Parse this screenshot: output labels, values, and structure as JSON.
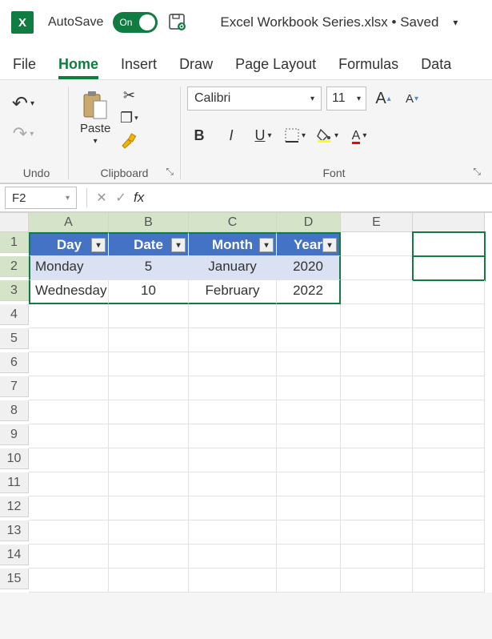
{
  "titlebar": {
    "autosave_label": "AutoSave",
    "toggle_state": "On",
    "doc_title": "Excel Workbook Series.xlsx • Saved"
  },
  "tabs": [
    "File",
    "Home",
    "Insert",
    "Draw",
    "Page Layout",
    "Formulas",
    "Data"
  ],
  "active_tab": "Home",
  "ribbon": {
    "undo_label": "Undo",
    "paste_label": "Paste",
    "clipboard_label": "Clipboard",
    "font_label": "Font",
    "font_name": "Calibri",
    "font_size": "11"
  },
  "namebox": "F2",
  "columns": [
    "A",
    "B",
    "C",
    "D",
    "E"
  ],
  "selected_cols": [
    "A",
    "B",
    "C",
    "D"
  ],
  "rows": [
    "1",
    "2",
    "3",
    "4",
    "5",
    "6",
    "7",
    "8",
    "9",
    "10",
    "11",
    "12",
    "13",
    "14",
    "15"
  ],
  "selected_rows": [
    "1",
    "2",
    "3"
  ],
  "table": {
    "headers": [
      "Day",
      "Date",
      "Month",
      "Year"
    ],
    "rows": [
      {
        "day": "Monday",
        "date": "5",
        "month": "January",
        "year": "2020"
      },
      {
        "day": "Wednesday",
        "date": "10",
        "month": "February",
        "year": "2022"
      }
    ]
  }
}
